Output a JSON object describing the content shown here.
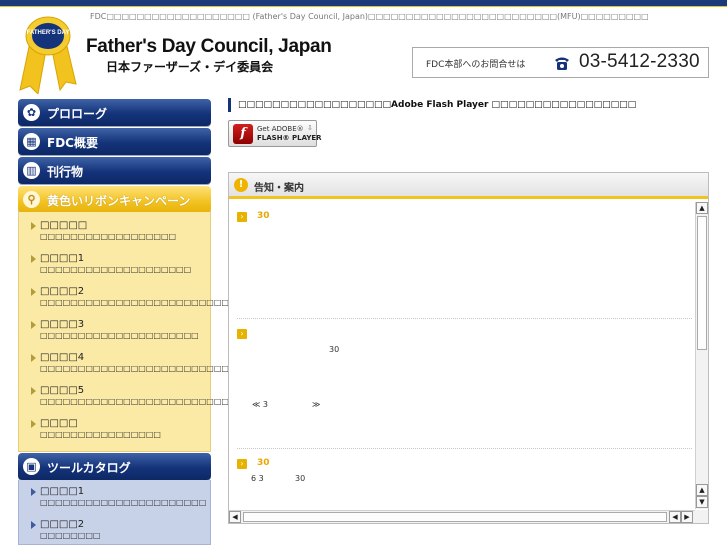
{
  "header": {
    "tagline": "FDC□□□□□□□□□□□□□□□□□□□ (Father's Day Council, Japan)□□□□□□□□□□□□□□□□□□□□□□□□□(MFU)□□□□□□□□□",
    "ribbon_text": "FATHER'S DAY",
    "brand_en": "Father's Day Council, Japan",
    "brand_ja": "日本ファーザーズ・デイ委員会",
    "contact_label": "FDC本部へのお問合せは",
    "contact_phone": "03-5412-2330"
  },
  "colors": {
    "navy": "#14337a",
    "yellow": "#f2c21f",
    "panel_yellow": "#fbeaa6",
    "panel_blue": "#c7d1e8"
  },
  "nav": {
    "items": [
      {
        "label": "プロローグ",
        "icon": "flower-icon",
        "glyph": "✿"
      },
      {
        "label": "FDC概要",
        "icon": "building-icon",
        "glyph": "▦"
      },
      {
        "label": "刊行物",
        "icon": "book-icon",
        "glyph": "▥"
      },
      {
        "label": "黄色いリボンキャンペーン",
        "icon": "ribbon-icon",
        "glyph": "⚲"
      },
      {
        "label": "ツールカタログ",
        "icon": "gift-icon",
        "glyph": "▣"
      }
    ]
  },
  "ribbon_subnav": [
    {
      "title": "□□□□□",
      "desc": "□□□□□□□□□□□□□□□□□□"
    },
    {
      "title": "□□□□1",
      "desc": "□□□□□□□□□□□□□□□□□□□□"
    },
    {
      "title": "□□□□2",
      "desc": "□□□□□□□□□□□□□□□□□□□□□□□□□□□□□"
    },
    {
      "title": "□□□□3",
      "desc": "□□□□□□□□□□□□□□□□□□□□□"
    },
    {
      "title": "□□□□4",
      "desc": "□□□□□□□□□□□□□□□□□□□□□□□□□□□"
    },
    {
      "title": "□□□□5",
      "desc": "□□□□□□□□□□□□□□□□□□□□□□□□□□□"
    },
    {
      "title": "□□□□",
      "desc": "□□□□□□□□□□□□□□□□"
    }
  ],
  "tool_subnav": [
    {
      "title": "□□□□1",
      "desc": "□□□□□□□□□□□□□□□□□□□□□□"
    },
    {
      "title": "□□□□2",
      "desc": "□□□□□□□□"
    }
  ],
  "flash": {
    "notice": "□□□□□□□□□□□□□□□□□□Adobe Flash Player □□□□□□□□□□□□□□□□□",
    "logo_glyph": "f",
    "btn_line1": "Get ADOBE®",
    "btn_line2": "FLASH® PLAYER",
    "btn_download_glyph": "⇩"
  },
  "notice": {
    "head_icon": "!",
    "title": "告知・案内",
    "items": [
      {
        "date": "30",
        "texts": []
      },
      {
        "date": "",
        "texts": [
          "30",
          "≪ 3",
          "≫"
        ]
      },
      {
        "date": "30",
        "texts": [
          "6 3",
          "30"
        ]
      }
    ],
    "scroll": {
      "up": "▲",
      "down": "▼",
      "left": "◀",
      "right": "▶",
      "grip": "⁞⁞⁞"
    }
  }
}
